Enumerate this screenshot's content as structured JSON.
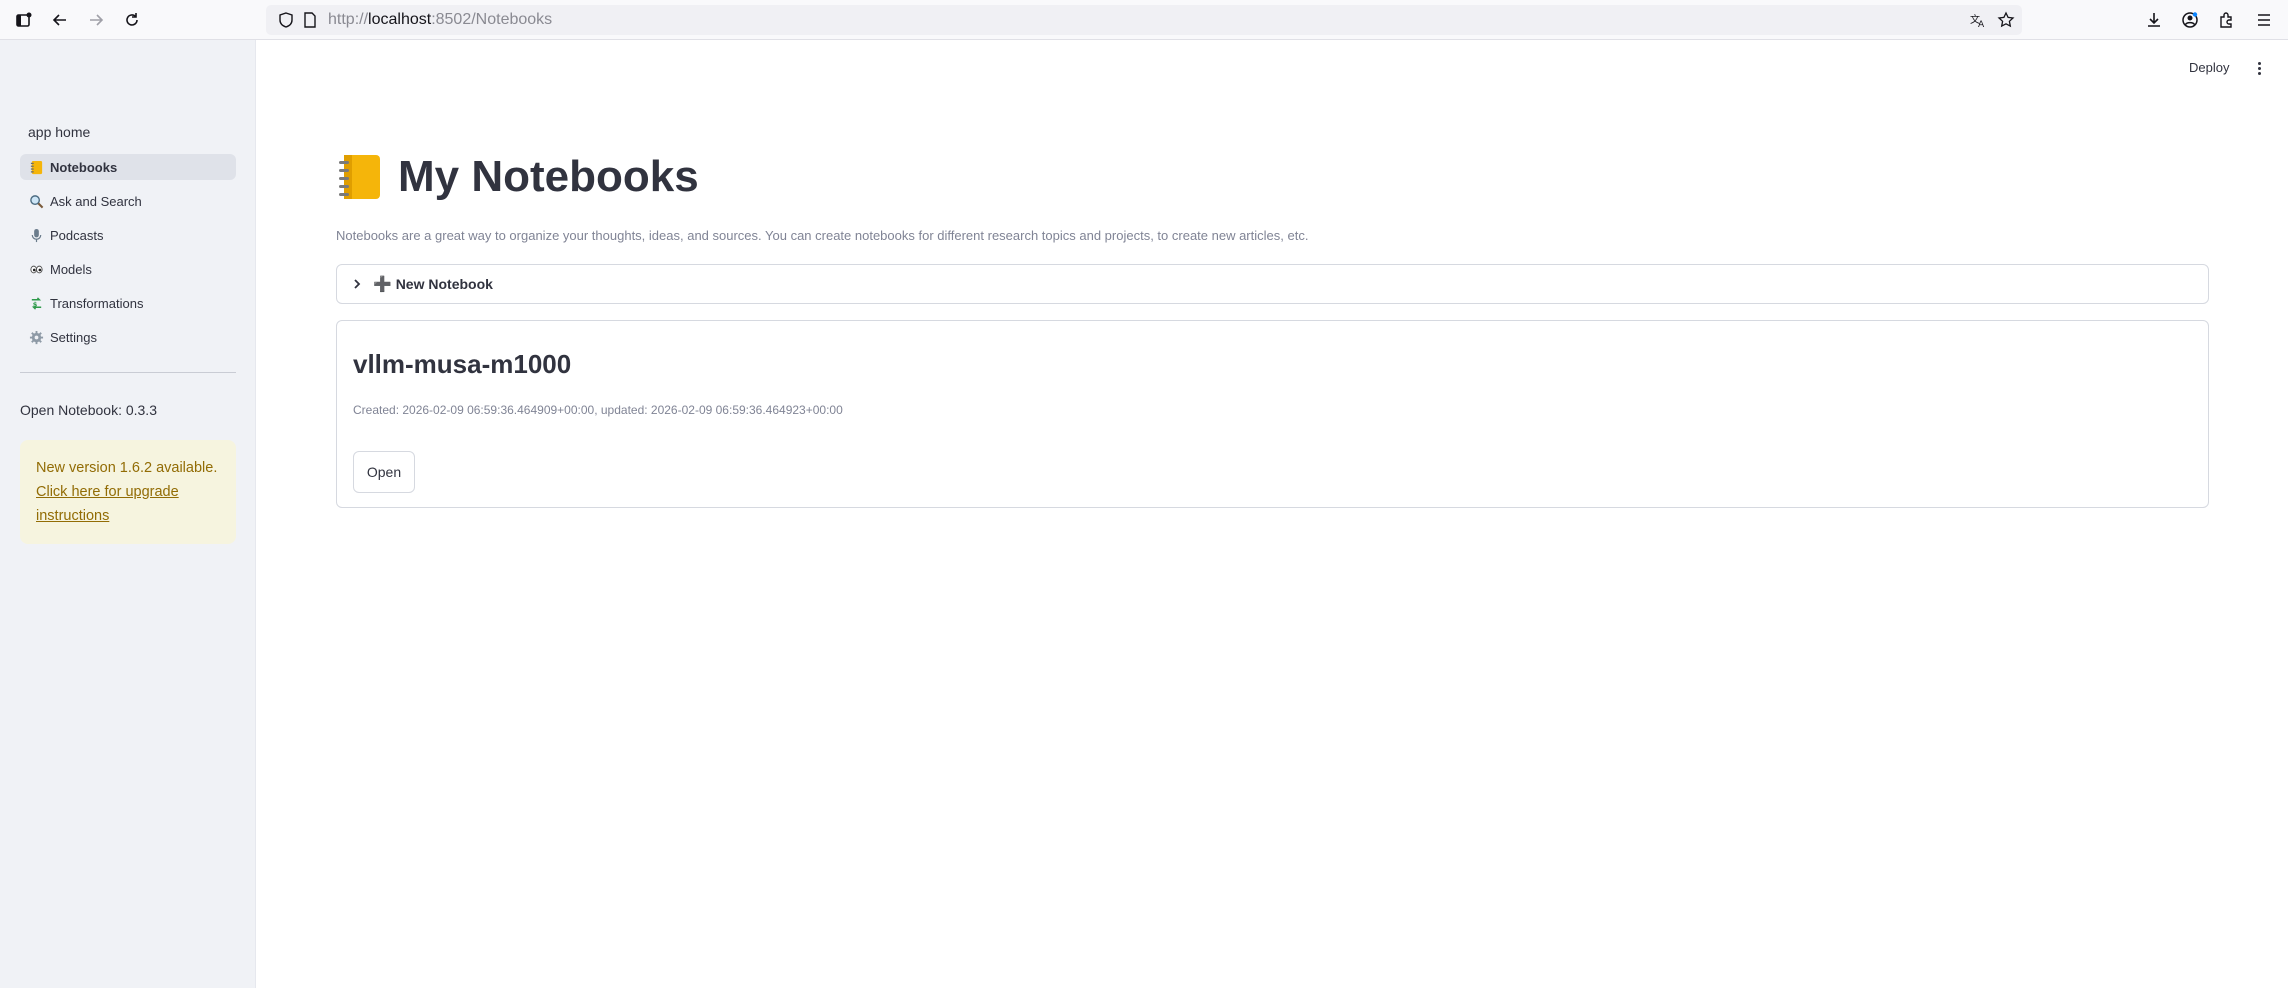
{
  "browser": {
    "url_prefix": "http://",
    "url_host": "localhost",
    "url_rest": ":8502/Notebooks"
  },
  "sidebar": {
    "section_title": "app home",
    "items": [
      {
        "label": "Notebooks",
        "icon": "notebook-icon",
        "active": true
      },
      {
        "label": "Ask and Search",
        "icon": "magnifier-icon",
        "active": false
      },
      {
        "label": "Podcasts",
        "icon": "microphone-icon",
        "active": false
      },
      {
        "label": "Models",
        "icon": "eyes-icon",
        "active": false
      },
      {
        "label": "Transformations",
        "icon": "currency-exchange-icon",
        "active": false
      },
      {
        "label": "Settings",
        "icon": "gear-icon",
        "active": false
      }
    ],
    "version": "Open Notebook: 0.3.3",
    "update_notice": {
      "text": "New version 1.6.2 available.",
      "link": "Click here for upgrade instructions"
    }
  },
  "header": {
    "deploy_label": "Deploy"
  },
  "main": {
    "title": "My Notebooks",
    "subtitle": "Notebooks are a great way to organize your thoughts, ideas, and sources. You can create notebooks for different research topics and projects, to create new articles, etc.",
    "new_notebook_label": "New Notebook",
    "notebooks": [
      {
        "name": "vllm-musa-m1000",
        "meta": "Created: 2026-02-09 06:59:36.464909+00:00, updated: 2026-02-09 06:59:36.464923+00:00",
        "open_label": "Open"
      }
    ]
  },
  "colors": {
    "sidebar_bg": "#f0f2f6",
    "active_item_bg": "#dfe2e9",
    "notice_bg": "#f6f4df",
    "notice_text": "#926c05",
    "text": "#31333f",
    "muted": "#808495"
  }
}
